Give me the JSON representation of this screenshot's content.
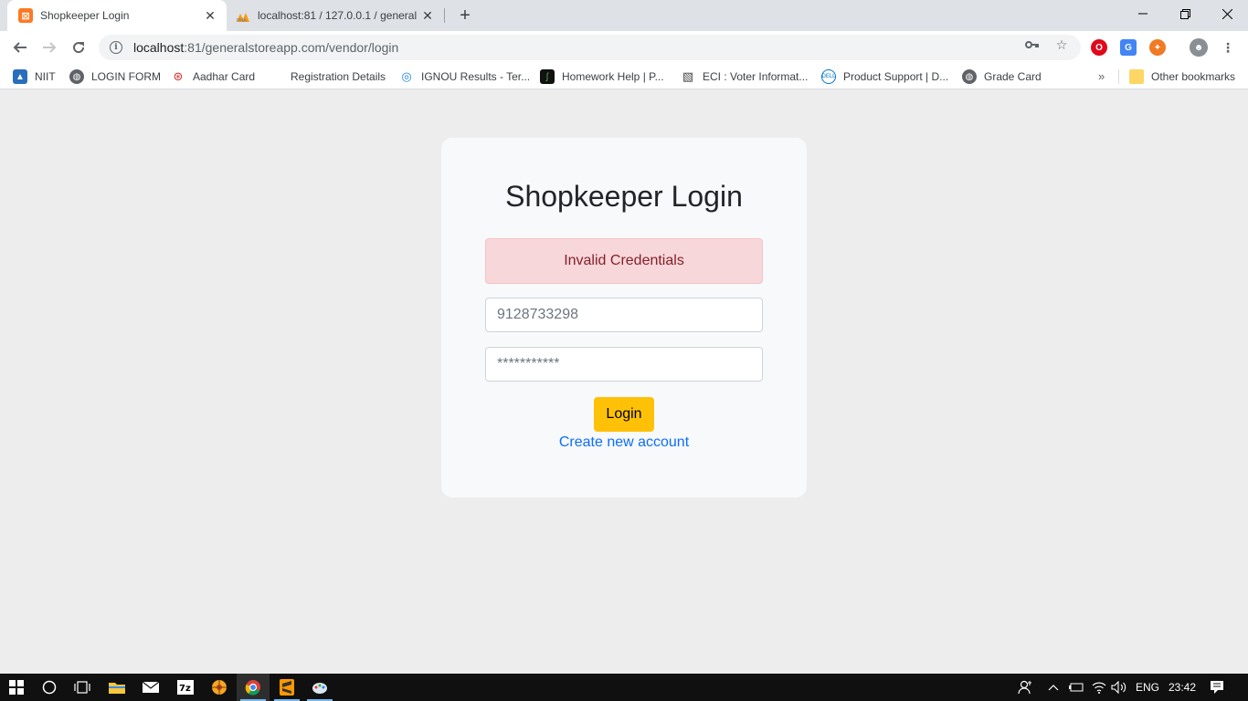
{
  "browser": {
    "tabs": [
      {
        "title": "Shopkeeper Login",
        "favicon": "xampp-icon",
        "active": true
      },
      {
        "title": "localhost:81 / 127.0.0.1 / general",
        "favicon": "phpmyadmin-icon",
        "active": false
      }
    ],
    "url_host": "localhost",
    "url_rest": ":81/generalstoreapp.com/vendor/login",
    "bookmarks": [
      {
        "label": "NIIT",
        "icon": "niit-icon"
      },
      {
        "label": "LOGIN FORM",
        "icon": "globe-icon"
      },
      {
        "label": "Aadhar Card",
        "icon": "aadhar-icon"
      },
      {
        "label": "Registration Details",
        "icon": "blank-icon"
      },
      {
        "label": "IGNOU Results - Ter...",
        "icon": "ignou-icon"
      },
      {
        "label": "Homework Help | P...",
        "icon": "homework-icon"
      },
      {
        "label": "ECI : Voter Informat...",
        "icon": "eci-icon"
      },
      {
        "label": "Product Support | D...",
        "icon": "dell-icon"
      },
      {
        "label": "Grade Card",
        "icon": "globe-icon"
      }
    ],
    "other_bookmarks": "Other bookmarks"
  },
  "page": {
    "title": "Shopkeeper Login",
    "alert": "Invalid Credentials",
    "phone_value": "9128733298",
    "password_placeholder": "***********",
    "login_label": "Login",
    "create_account_label": "Create new account"
  },
  "taskbar": {
    "language": "ENG",
    "time": "23:42"
  },
  "colors": {
    "accent_button": "#ffc107",
    "alert_bg": "#f8d7da",
    "link": "#0d6efd"
  }
}
